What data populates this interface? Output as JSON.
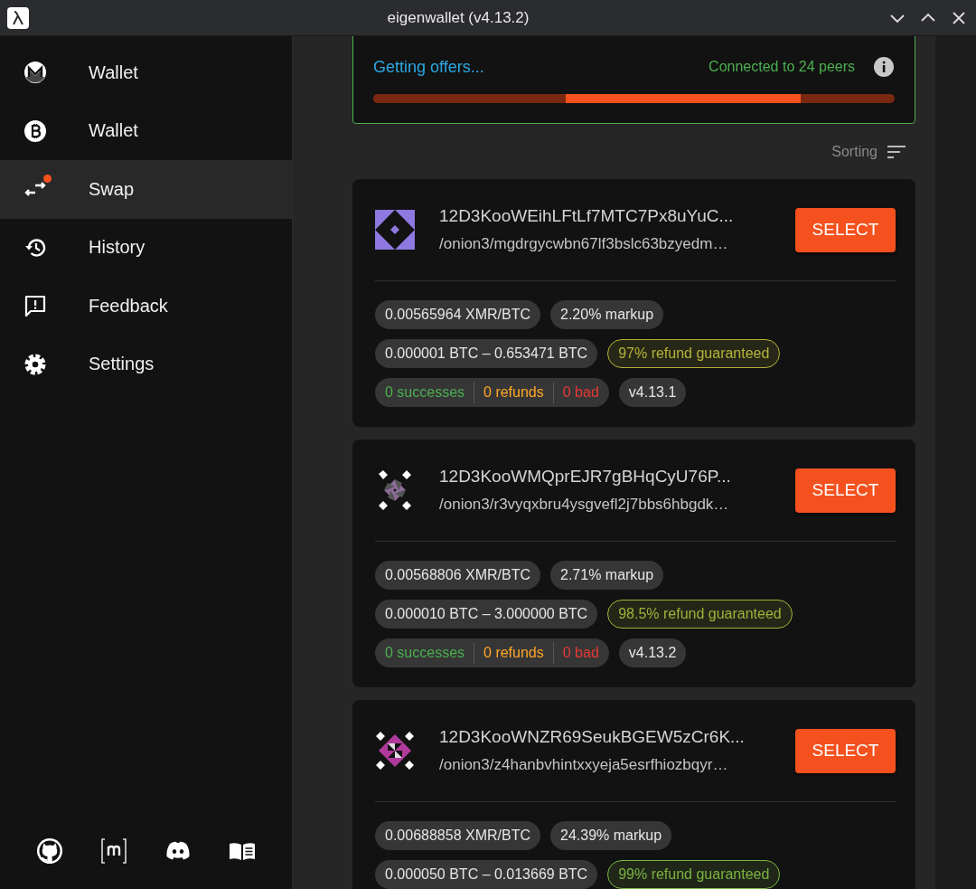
{
  "window": {
    "title": "eigenwallet (v4.13.2)"
  },
  "sidebar": {
    "items": [
      {
        "label": "Wallet",
        "kind": "monero",
        "selected": false,
        "badge": false
      },
      {
        "label": "Wallet",
        "kind": "bitcoin",
        "selected": false,
        "badge": false
      },
      {
        "label": "Swap",
        "kind": "swap",
        "selected": true,
        "badge": true
      },
      {
        "label": "History",
        "kind": "history",
        "selected": false,
        "badge": false
      },
      {
        "label": "Feedback",
        "kind": "feedback",
        "selected": false,
        "badge": false
      },
      {
        "label": "Settings",
        "kind": "settings",
        "selected": false,
        "badge": false
      }
    ],
    "footer_links": [
      {
        "kind": "github"
      },
      {
        "kind": "matrix"
      },
      {
        "kind": "discord"
      },
      {
        "kind": "docs"
      }
    ]
  },
  "status": {
    "message": "Getting offers...",
    "peers": "Connected to 24 peers",
    "level": 0.82
  },
  "sorting": {
    "label": "Sorting"
  },
  "offers": [
    {
      "peer_id": "12D3KooWEihLFtLf7MTC7Px8uYuC...",
      "address": "/onion3/mgdrgycwbn67lf3bslc63bzyedm…",
      "kind": "diamond",
      "color": "#8f78e0",
      "button": "SELECT",
      "rate": "0.00565964 XMR/BTC",
      "markup": "2.20% markup",
      "range": "0.000001 BTC – 0.653471 BTC",
      "refund": {
        "text": "97% refund guaranteed",
        "color": "#b5b33a"
      },
      "stats": {
        "successes": "0 successes",
        "refunds": "0 refunds",
        "bad": "0 bad"
      },
      "version": "v4.13.1"
    },
    {
      "peer_id": "12D3KooWMQprEJR7gBHqCyU76P...",
      "address": "/onion3/r3vyqxbru4ysgvefl2j7bbs6hbgdk…",
      "kind": "pinwheel",
      "color": "#8a6c96",
      "button": "SELECT",
      "rate": "0.00568806 XMR/BTC",
      "markup": "2.71% markup",
      "range": "0.000010 BTC – 3.000000 BTC",
      "refund": {
        "text": "98.5% refund guaranteed",
        "color": "#9cb43a"
      },
      "stats": {
        "successes": "0 successes",
        "refunds": "0 refunds",
        "bad": "0 bad"
      },
      "version": "v4.13.2"
    },
    {
      "peer_id": "12D3KooWNZR69SeukBGEW5zCr6K...",
      "address": "/onion3/z4hanbvhintxxyeja5esrfhiozbqyr…",
      "kind": "cross",
      "color": "#b03a9c",
      "button": "SELECT",
      "rate": "0.00688858 XMR/BTC",
      "markup": "24.39% markup",
      "range": "0.000050 BTC – 0.013669 BTC",
      "refund": {
        "text": "99% refund guaranteed",
        "color": "#7cb342"
      }
    }
  ]
}
